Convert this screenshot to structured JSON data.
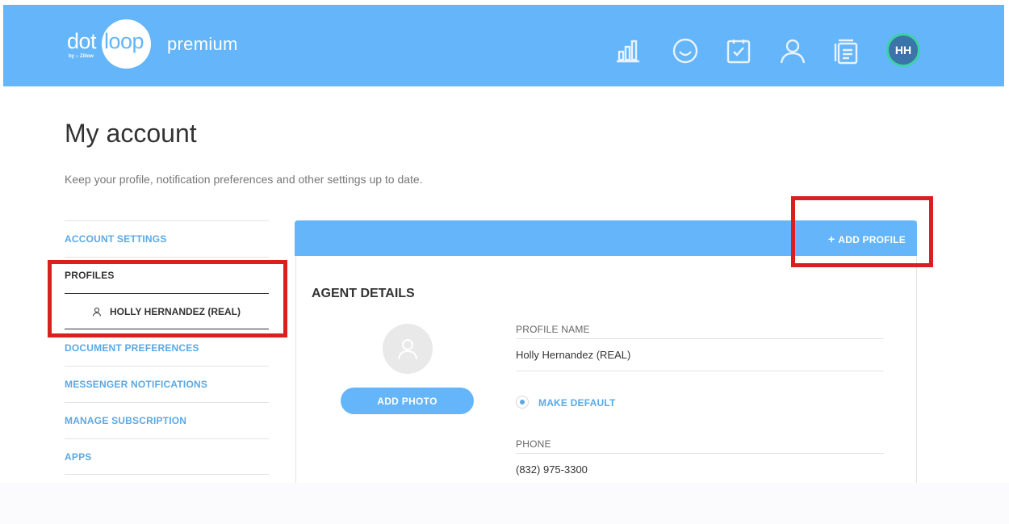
{
  "header": {
    "logo_dot": "dot",
    "logo_loop": "loop",
    "logo_by": "by ⌂ Zillow",
    "plan": "premium",
    "icons": [
      "bar-chart-icon",
      "smiley-icon",
      "checkbox-icon",
      "person-icon",
      "documents-icon"
    ],
    "avatar_initials": "HH",
    "colors": {
      "header_bg": "#64b5f9",
      "avatar_bg": "#3a74a8",
      "avatar_ring": "#3ed1a8"
    }
  },
  "page": {
    "title": "My account",
    "subtitle": "Keep your profile, notification preferences and other settings up to date."
  },
  "sidebar": {
    "items": [
      {
        "label": "ACCOUNT SETTINGS"
      },
      {
        "label": "PROFILES"
      },
      {
        "label": "HOLLY HERNANDEZ (REAL)"
      },
      {
        "label": "DOCUMENT PREFERENCES"
      },
      {
        "label": "MESSENGER NOTIFICATIONS"
      },
      {
        "label": "MANAGE SUBSCRIPTION"
      },
      {
        "label": "APPS"
      }
    ]
  },
  "panel": {
    "add_profile_label": "ADD PROFILE",
    "section_title": "AGENT DETAILS",
    "add_photo_label": "ADD PHOTO",
    "profile_name_label": "PROFILE NAME",
    "profile_name_value": "Holly Hernandez (REAL)",
    "make_default_label": "MAKE DEFAULT",
    "phone_label": "PHONE",
    "phone_value": "(832) 975-3300"
  },
  "highlight_color": "#d9201f"
}
